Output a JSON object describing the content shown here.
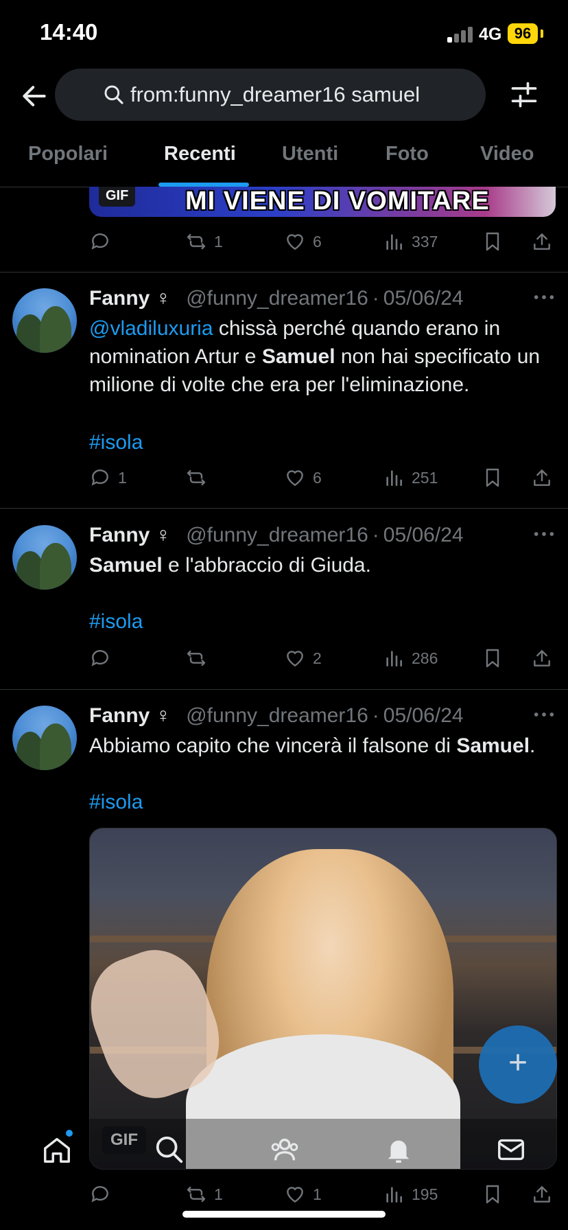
{
  "status_bar": {
    "time": "14:40",
    "network": "4G",
    "battery": "96"
  },
  "search": {
    "query": "from:funny_dreamer16 samuel"
  },
  "tabs": [
    {
      "label": "Popolari"
    },
    {
      "label": "Recenti"
    },
    {
      "label": "Utenti"
    },
    {
      "label": "Foto"
    },
    {
      "label": "Video"
    }
  ],
  "top_tweet": {
    "gif_badge": "GIF",
    "gif_caption": "MI VIENE DI VOMITARE",
    "actions": {
      "replies": "",
      "retweets": "1",
      "likes": "6",
      "views": "337"
    }
  },
  "tweets": [
    {
      "name": "Fanny ♀",
      "handle": "@funny_dreamer16",
      "sep": "·",
      "date": "05/06/24",
      "mention": "@vladiluxuria",
      "text_a": " chissà perché quando erano in nomination Artur e ",
      "bold": "Samuel",
      "text_b": " non hai specificato un milione di volte che era per l'eliminazione.",
      "hashtag": "#isola",
      "actions": {
        "replies": "1",
        "retweets": "",
        "likes": "6",
        "views": "251"
      }
    },
    {
      "name": "Fanny ♀",
      "handle": "@funny_dreamer16",
      "sep": "·",
      "date": "05/06/24",
      "bold": "Samuel",
      "text_b": " e l'abbraccio di Giuda.",
      "hashtag": "#isola",
      "actions": {
        "replies": "",
        "retweets": "",
        "likes": "2",
        "views": "286"
      }
    },
    {
      "name": "Fanny ♀",
      "handle": "@funny_dreamer16",
      "sep": "·",
      "date": "05/06/24",
      "text_a": "Abbiamo capito che vincerà il falsone di ",
      "bold": "Samuel",
      "text_b": ".",
      "hashtag": "#isola",
      "gif_badge": "GIF",
      "actions": {
        "replies": "",
        "retweets": "1",
        "likes": "1",
        "views": "195"
      }
    }
  ],
  "fab": {
    "icon": "+"
  },
  "colors": {
    "accent": "#1d9bf0",
    "background": "#000000",
    "secondary_text": "#71767b"
  }
}
